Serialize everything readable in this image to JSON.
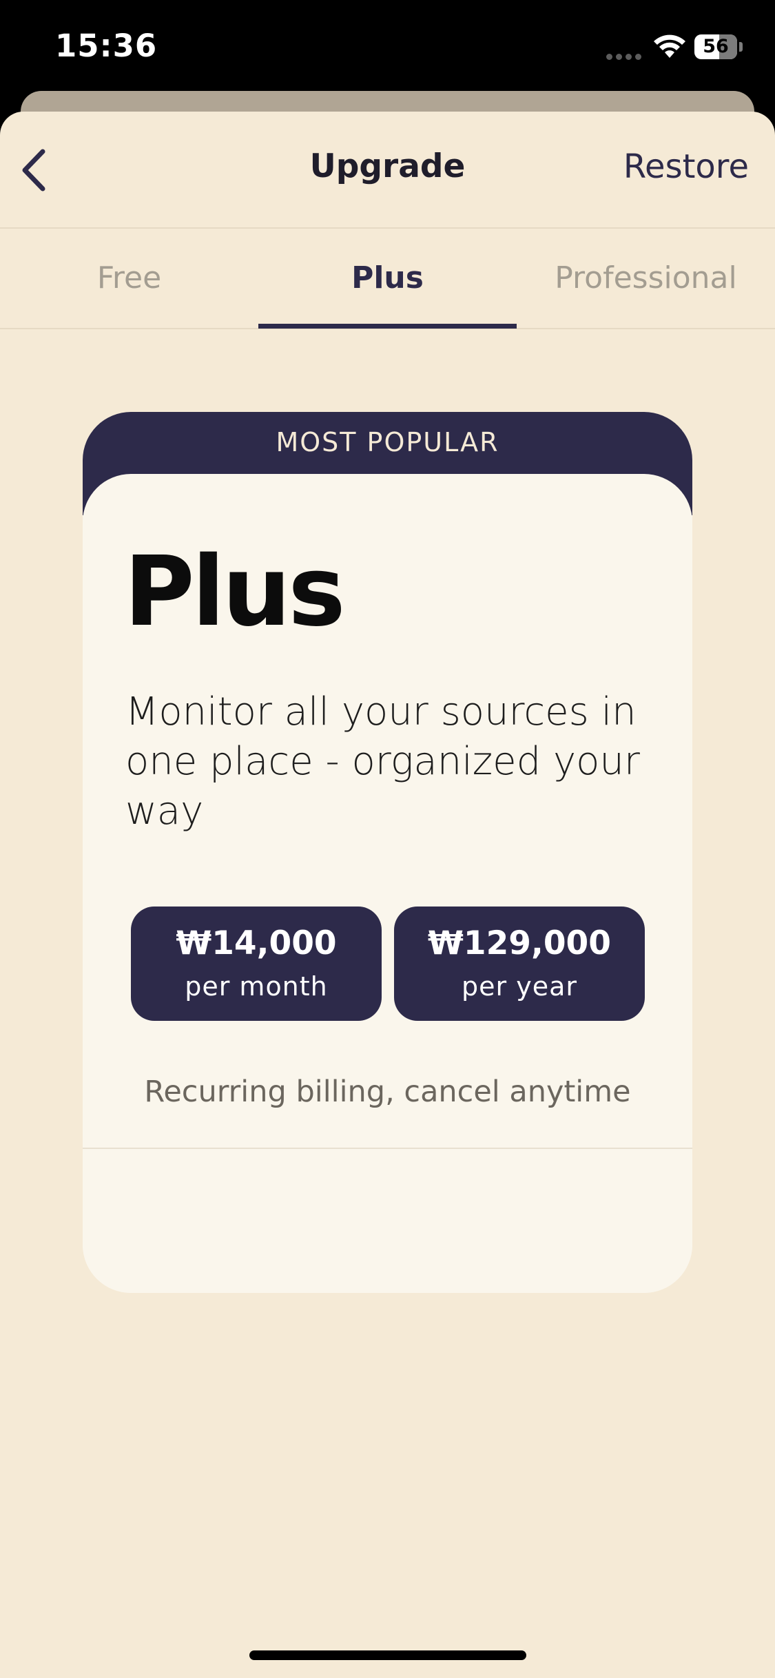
{
  "status_bar": {
    "time": "15:36",
    "battery": "56",
    "icons": [
      "signal-dots-icon",
      "wifi-icon",
      "battery-icon"
    ]
  },
  "nav": {
    "back_icon": "chevron-left-icon",
    "title": "Upgrade",
    "restore_label": "Restore"
  },
  "tabs": [
    {
      "label": "Free",
      "active": false
    },
    {
      "label": "Plus",
      "active": true
    },
    {
      "label": "Professional",
      "active": false
    }
  ],
  "card": {
    "banner": "MOST POPULAR",
    "plan_name": "Plus",
    "description": "Monitor all your sources in one place - organized your way",
    "prices": [
      {
        "amount": "₩14,000",
        "period": "per month"
      },
      {
        "amount": "₩129,000",
        "period": "per year"
      }
    ],
    "billing_note": "Recurring billing, cancel anytime"
  },
  "colors": {
    "accent": "#2d2a4a",
    "background": "#f5ead6",
    "card": "#faf6ec"
  }
}
